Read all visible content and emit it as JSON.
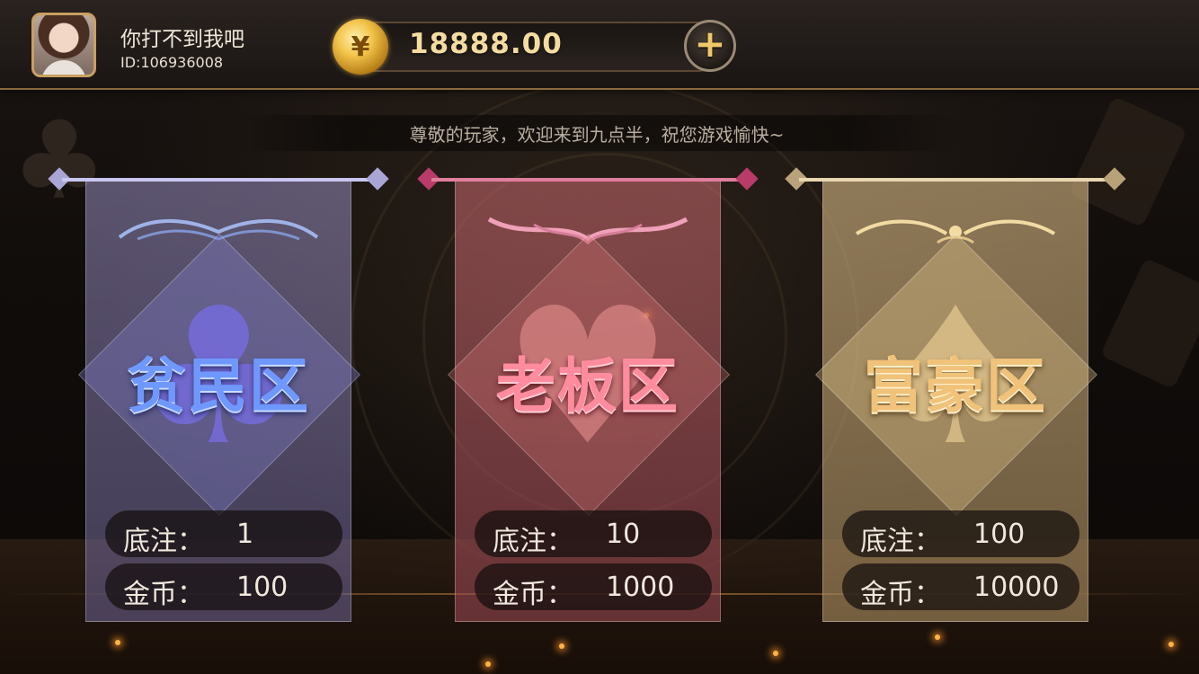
{
  "player": {
    "name": "你打不到我吧",
    "id_label": "ID:106936008"
  },
  "wallet": {
    "coin_symbol": "¥",
    "balance": "18888.00",
    "add_symbol": "+"
  },
  "notice": {
    "text": "尊敬的玩家，欢迎来到九点半，祝您游戏愉快~"
  },
  "rooms": [
    {
      "name": "贫民区",
      "suit_icon": "club",
      "suit_glyph": "♣",
      "ante_label": "底注：",
      "ante_value": "1",
      "coin_label": "金币：",
      "coin_value": "100"
    },
    {
      "name": "老板区",
      "suit_icon": "heart",
      "suit_glyph": "♥",
      "ante_label": "底注：",
      "ante_value": "10",
      "coin_label": "金币：",
      "coin_value": "1000"
    },
    {
      "name": "富豪区",
      "suit_icon": "spade",
      "suit_glyph": "♠",
      "ante_label": "底注：",
      "ante_value": "100",
      "coin_label": "金币：",
      "coin_value": "10000"
    }
  ],
  "colors": {
    "gold_accent": "#c8a060",
    "poor_room": "#6f98ff",
    "boss_room": "#ff8c9e",
    "rich_room": "#f0c27a"
  }
}
